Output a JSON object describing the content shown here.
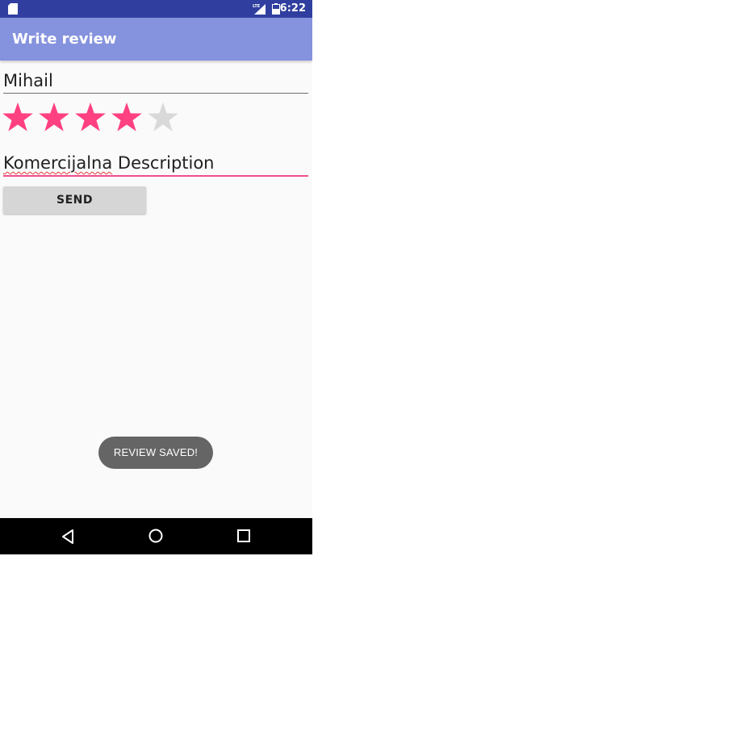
{
  "status_bar": {
    "time": "6:22",
    "icons": [
      "sd-card-icon",
      "lte-signal-icon",
      "battery-icon"
    ],
    "background": "#303f9f"
  },
  "app_bar": {
    "title": "Write review",
    "background": "#8592dd"
  },
  "form": {
    "name_value": "Mihail",
    "rating": {
      "value": 4,
      "max": 5,
      "filled_color": "#ff4081",
      "empty_color": "#d9d9d9"
    },
    "description_value_word1": "Komercijalna",
    "description_value_word2": " Description",
    "description_underline_color": "#ef4f8f",
    "send_label": "SEND"
  },
  "toast": {
    "message": "REVIEW SAVED!"
  },
  "nav_bar": {
    "icons": [
      "back-icon",
      "home-icon",
      "recents-icon"
    ]
  }
}
